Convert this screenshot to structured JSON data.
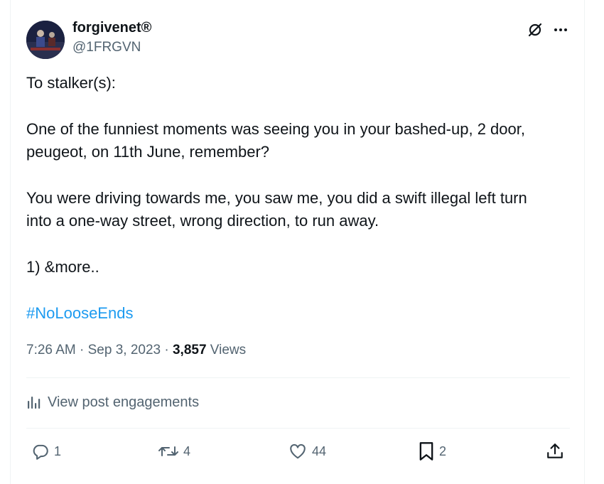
{
  "author": {
    "name": "forgivenet®",
    "handle": "@1FRGVN"
  },
  "post": {
    "line1": "To stalker(s):",
    "line2": "One of the funniest moments was seeing you in your bashed-up, 2 door,",
    "line3": "peugeot, on 11th June, remember?",
    "line4": "You were driving towards me, you saw me, you did a swift illegal left turn",
    "line5": "into a one-way street, wrong direction, to run away.",
    "line6": "1) &more..",
    "hashtag": "#NoLooseEnds"
  },
  "meta": {
    "time": "7:26 AM",
    "sep1": " · ",
    "date": "Sep 3, 2023",
    "sep2": " · ",
    "views_count": "3,857",
    "views_label": " Views"
  },
  "engagements_label": "View post engagements",
  "actions": {
    "replies": "1",
    "reposts": "4",
    "likes": "44",
    "bookmarks": "2"
  },
  "icons": {
    "top": [
      "grok-icon",
      "more-icon"
    ],
    "actions": [
      "reply-icon",
      "repost-icon",
      "like-icon",
      "bookmark-icon",
      "share-icon"
    ]
  },
  "colors": {
    "text": "#0f1419",
    "secondary": "#536471",
    "link": "#1d9bf0",
    "divider": "#eff3f4"
  }
}
